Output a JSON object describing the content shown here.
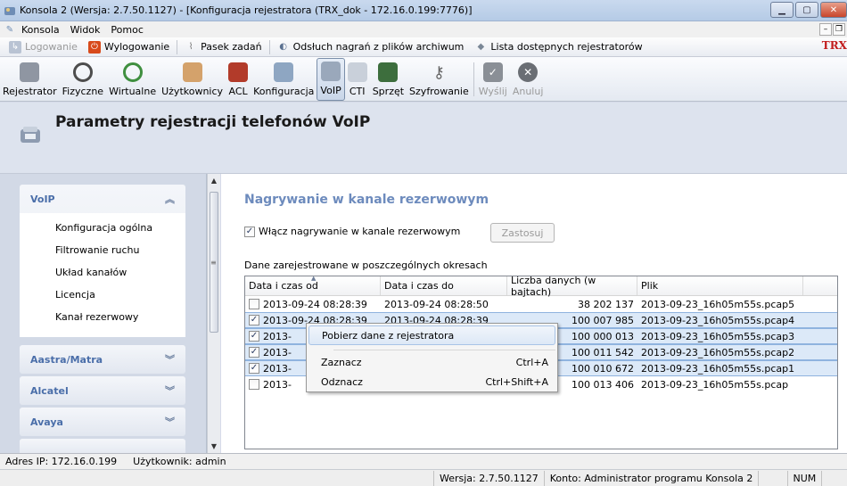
{
  "window": {
    "title": "Konsola 2 (Wersja:  2.7.50.1127) - [Konfiguracja rejestratora (TRX_dok - 172.16.0.199:7776)]"
  },
  "menubar": [
    "Konsola",
    "Widok",
    "Pomoc"
  ],
  "taskbar": {
    "logowanie": "Logowanie",
    "wylogowanie": "Wylogowanie",
    "pasek_zadan": "Pasek zadań",
    "odsluch": "Odsłuch nagrań z plików archiwum",
    "lista": "Lista dostępnych rejestratorów",
    "brand": "TRX"
  },
  "toolbar": [
    {
      "label": "Rejestrator",
      "icon": "recorder-icon"
    },
    {
      "label": "Fizyczne",
      "icon": "physical-channel-icon"
    },
    {
      "label": "Wirtualne",
      "icon": "virtual-channel-icon"
    },
    {
      "label": "Użytkownicy",
      "icon": "users-icon"
    },
    {
      "label": "ACL",
      "icon": "acl-icon"
    },
    {
      "label": "Konfiguracja",
      "icon": "configuration-icon"
    },
    {
      "label": "VoIP",
      "icon": "voip-phone-icon",
      "active": true
    },
    {
      "label": "CTI",
      "icon": "cti-icon"
    },
    {
      "label": "Sprzęt",
      "icon": "hardware-icon"
    },
    {
      "label": "Szyfrowanie",
      "icon": "encryption-key-icon"
    },
    {
      "label": "Wyślij",
      "icon": "send-check-icon",
      "disabled": true
    },
    {
      "label": "Anuluj",
      "icon": "cancel-icon",
      "disabled": true
    }
  ],
  "header": {
    "title": "Parametry rejestracji telefonów VoIP"
  },
  "sidebar": {
    "voip_section": "VoIP",
    "links": [
      "Konfiguracja ogólna",
      "Filtrowanie ruchu",
      "Układ kanałów",
      "Licencja",
      "Kanał rezerwowy"
    ],
    "collapsed_sections": [
      "Aastra/Matra",
      "Alcatel",
      "Avaya"
    ]
  },
  "content": {
    "subtitle": "Nagrywanie w kanale rezerwowym",
    "enable_checkbox_label": "Włącz nagrywanie w kanale rezerwowym",
    "apply_button": "Zastosuj",
    "table_caption": "Dane zarejestrowane w poszczególnych okresach",
    "columns": [
      "Data i czas od",
      "Data i czas do",
      "Liczba danych (w bajtach)",
      "Plik"
    ],
    "rows": [
      {
        "checked": false,
        "from": "2013-09-24 08:28:39",
        "to": "2013-09-24 08:28:50",
        "bytes": "38 202 137",
        "file": "2013-09-23_16h05m55s.pcap5",
        "selected": false
      },
      {
        "checked": true,
        "from": "2013-09-24 08:28:39",
        "to": "2013-09-24 08:28:39",
        "bytes": "100 007 985",
        "file": "2013-09-23_16h05m55s.pcap4",
        "selected": true
      },
      {
        "checked": true,
        "from": "2013-",
        "to": "",
        "bytes": "100 000 013",
        "file": "2013-09-23_16h05m55s.pcap3",
        "selected": true
      },
      {
        "checked": true,
        "from": "2013-",
        "to": "",
        "bytes": "100 011 542",
        "file": "2013-09-23_16h05m55s.pcap2",
        "selected": true
      },
      {
        "checked": true,
        "from": "2013-",
        "to": "",
        "bytes": "100 010 672",
        "file": "2013-09-23_16h05m55s.pcap1",
        "selected": true
      },
      {
        "checked": false,
        "from": "2013-",
        "to": "",
        "bytes": "100 013 406",
        "file": "2013-09-23_16h05m55s.pcap",
        "selected": false
      }
    ]
  },
  "context_menu": {
    "download": "Pobierz dane z rejestratora",
    "select": "Zaznacz",
    "select_shortcut": "Ctrl+A",
    "deselect": "Odznacz",
    "deselect_shortcut": "Ctrl+Shift+A"
  },
  "status": {
    "ip": "Adres IP: 172.16.0.199",
    "user": "Użytkownik: admin",
    "version": "Wersja: 2.7.50.1127",
    "account": "Konto: Administrator programu Konsola 2",
    "num": "NUM"
  },
  "colors": {
    "accent_blue": "#6d8bbd",
    "section_title": "#4a6ea9",
    "selection": "#dce9f8",
    "logout_red": "#d84a1b"
  }
}
